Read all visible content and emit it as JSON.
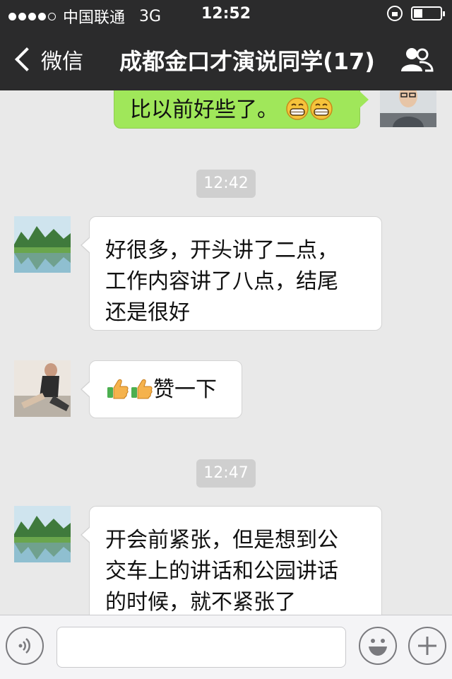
{
  "status_bar": {
    "carrier": "中国联通",
    "network": "3G",
    "time": "12:52"
  },
  "nav": {
    "back_label": "微信",
    "title": "成都金口才演说同学(17)"
  },
  "messages": [
    {
      "side": "right",
      "text": "比以前好些了。"
    },
    {
      "timestamp": "12:42"
    },
    {
      "side": "left",
      "text_lines": [
        "好很多，开头讲了二点，",
        "工作内容讲了八点，结尾",
        "还是很好"
      ]
    },
    {
      "side": "left",
      "text": "赞一下"
    },
    {
      "timestamp": "12:47"
    },
    {
      "side": "left",
      "text_lines": [
        "开会前紧张，但是想到公",
        "交车上的讲话和公园讲话",
        "的时候，就不紧张了"
      ]
    }
  ],
  "icons": {
    "msg1_emoji": "grinning-face-icon",
    "msg4_emoji": "thumbs-up-icon",
    "voice": "voice-icon",
    "emoji_button": "smiley-icon",
    "more": "plus-icon",
    "group": "group-icon"
  },
  "colors": {
    "bar": "#2b2b2c",
    "my_bubble": "#a0e75a",
    "background": "#e9e9e9"
  }
}
